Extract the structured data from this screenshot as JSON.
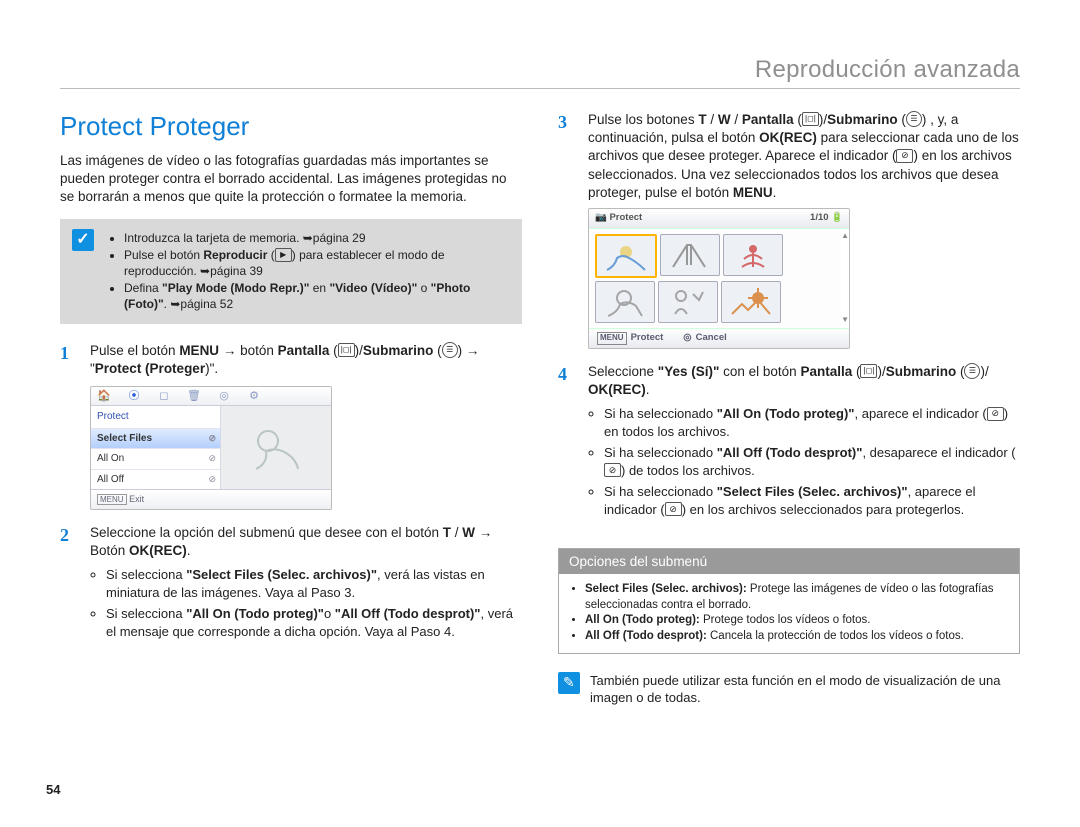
{
  "header": {
    "title": "Reproducción avanzada"
  },
  "page_num": "54",
  "left": {
    "title": "Protect Proteger",
    "intro": "Las imágenes de vídeo o las fotografías guardadas más importantes se pueden proteger contra el borrado accidental. Las imágenes protegidas no se borrarán a menos que quite la protección o formatee la memoria.",
    "prereq": {
      "items": [
        {
          "html": "Introduzca la tarjeta de memoria. ➥página 29"
        },
        {
          "html": "Pulse el botón <b>Reproducir</b> (<span class='inline-icon'>▶</span>) para establecer el modo de reproducción. ➥página 39"
        },
        {
          "html": "Defina <b>\"Play Mode (Modo Repr.)\"</b> en <b>\"Video (Vídeo)\"</b> o <b>\"Photo (Foto)\"</b>. ➥página 52"
        }
      ]
    },
    "step1": "Pulse el botón <b>MENU</b> → botón <b>Pantalla</b> (<span class='inline-icon'>|◻|</span>)/<b>Submarino</b> (<span class='inline-icon round'>☰</span>) → \"<b>Protect (Proteger</b>)\".",
    "menu": {
      "header": "Protect",
      "opt1": "Select Files",
      "opt2": "All On",
      "opt3": "All Off",
      "exit": "Exit"
    },
    "step2": "Seleccione la opción del submenú que desee con el botón <b>T</b> / <b>W</b> → Botón <b>OK(REC)</b>.",
    "step2_sub": [
      "Si selecciona <b>\"Select Files (Selec. archivos)\"</b>, verá las vistas en miniatura de las imágenes. Vaya al Paso 3.",
      "Si selecciona <b>\"All On (Todo proteg)\"</b>o <b>\"All Off (Todo desprot)\"</b>, verá el mensaje que corresponde a dicha opción. Vaya al Paso 4."
    ]
  },
  "right": {
    "step3": "Pulse los botones <b>T</b> / <b>W</b> / <b>Pantalla</b> (<span class='inline-icon'>|◻|</span>)/<b>Submarino</b> (<span class='inline-icon round'>☰</span>) , y, a continuación, pulsa el botón <b>OK(REC)</b> para seleccionar cada uno de los archivos que desee proteger. Aparece el indicador (<span class='inline-icon key'>⊘</span>) en los archivos seleccionados. Una vez seleccionados todos los archivos que desea proteger, pulse el botón <b>MENU</b>.",
    "grid": {
      "title": "Protect",
      "count": "1/10",
      "protect": "Protect",
      "cancel": "Cancel"
    },
    "step4": "Seleccione <b>\"Yes (Sí)\"</b> con el botón <b>Pantalla</b> (<span class='inline-icon'>|◻|</span>)/<b>Submarino</b> (<span class='inline-icon round'>☰</span>)/ <b>OK(REC)</b>.",
    "step4_sub": [
      "Si ha seleccionado <b>\"All On (Todo proteg)\"</b>, aparece el indicador (<span class='inline-icon key'>⊘</span>) en todos los archivos.",
      "Si ha seleccionado <b>\"All Off (Todo desprot)\"</b>, desaparece el indicador (<span class='inline-icon key'>⊘</span>) de todos los archivos.",
      "Si ha seleccionado <b>\"Select Files (Selec. archivos)\"</b>, aparece el indicador  (<span class='inline-icon key'>⊘</span>) en los archivos seleccionados para protegerlos."
    ],
    "opts": {
      "title": "Opciones del submenú",
      "items": [
        "<b>Select Files (Selec. archivos):</b> Protege las imágenes de vídeo o las fotografías seleccionadas contra el borrado.",
        "<b>All On (Todo proteg):</b> Protege todos los vídeos o fotos.",
        "<b>All Off (Todo desprot):</b> Cancela la protección de todos los vídeos o fotos."
      ]
    },
    "note": "También puede utilizar esta función en el modo de visualización de una imagen o de todas."
  }
}
